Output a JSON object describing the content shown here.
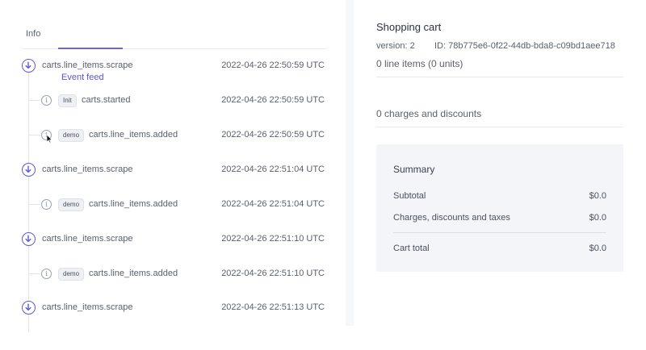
{
  "tabs": [
    {
      "label": "Info",
      "active": false
    },
    {
      "label": "Event feed",
      "active": true
    }
  ],
  "events": [
    {
      "kind": "parent",
      "name": "carts.line_items.scrape",
      "time": "2022-04-26 22:50:59 UTC"
    },
    {
      "kind": "child",
      "badge": "Init",
      "name": "carts.started",
      "time": "2022-04-26 22:50:59 UTC"
    },
    {
      "kind": "child",
      "badge": "demo",
      "name": "carts.line_items.added",
      "time": "2022-04-26 22:50:59 UTC"
    },
    {
      "kind": "parent",
      "name": "carts.line_items.scrape",
      "time": "2022-04-26 22:51:04 UTC"
    },
    {
      "kind": "child",
      "badge": "demo",
      "name": "carts.line_items.added",
      "time": "2022-04-26 22:51:04 UTC"
    },
    {
      "kind": "parent",
      "name": "carts.line_items.scrape",
      "time": "2022-04-26 22:51:10 UTC"
    },
    {
      "kind": "child",
      "badge": "demo",
      "name": "carts.line_items.added",
      "time": "2022-04-26 22:51:10 UTC"
    },
    {
      "kind": "parent",
      "name": "carts.line_items.scrape",
      "time": "2022-04-26 22:51:13 UTC"
    }
  ],
  "icons": {
    "parent": "arrow-down-circle-icon",
    "child": "info-circle-icon"
  },
  "cart": {
    "title": "Shopping cart",
    "version": "version: 2",
    "id": "ID: 78b775e6-0f22-44db-bda8-c09bd1aee718",
    "line_items": "0 line items (0 units)",
    "charges": "0 charges and discounts"
  },
  "summary": {
    "title": "Summary",
    "rows": [
      {
        "label": "Subtotal",
        "value": "$0.0"
      },
      {
        "label": "Charges, discounts and taxes",
        "value": "$0.0"
      }
    ],
    "total": {
      "label": "Cart total",
      "value": "$0.0"
    }
  },
  "colors": {
    "accent": "#5d59d8",
    "summary_bg": "#f3f5f8"
  }
}
